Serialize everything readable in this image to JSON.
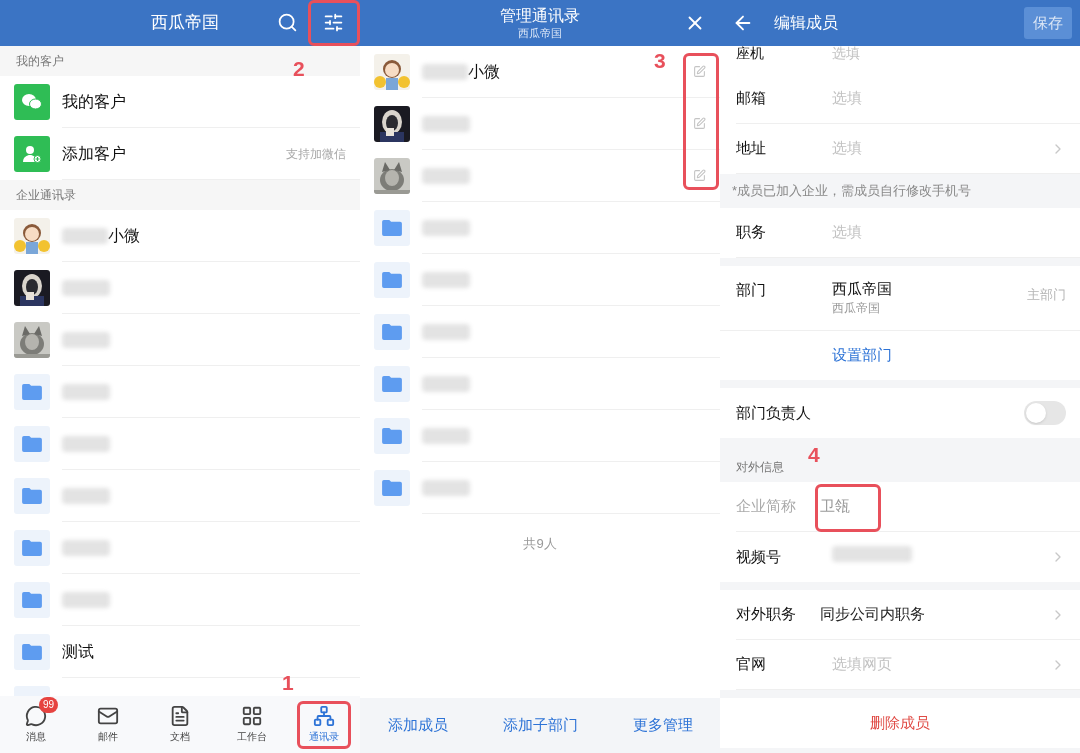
{
  "contacts_screen": {
    "title": "西瓜帝国",
    "sections": [
      {
        "header": "我的客户",
        "items": [
          {
            "kind": "wechat",
            "name": "我的客户",
            "blurred": false
          },
          {
            "kind": "add",
            "name": "添加客户",
            "note": "支持加微信",
            "blurred": false
          }
        ]
      },
      {
        "header": "企业通讯录",
        "items": [
          {
            "kind": "member",
            "blurred": true,
            "name": "小微"
          },
          {
            "kind": "member",
            "blurred": true
          },
          {
            "kind": "member",
            "blurred": true
          },
          {
            "kind": "folder",
            "blurred": true
          },
          {
            "kind": "folder",
            "blurred": true
          },
          {
            "kind": "folder",
            "blurred": true
          },
          {
            "kind": "folder",
            "blurred": true
          },
          {
            "kind": "folder",
            "blurred": true
          },
          {
            "kind": "folder",
            "name": "测试",
            "blurred": false
          },
          {
            "kind": "folder",
            "blurred": false
          }
        ]
      }
    ],
    "tabs": [
      {
        "label": "消息",
        "badge": "99",
        "selected": false
      },
      {
        "label": "邮件",
        "selected": false
      },
      {
        "label": "文档",
        "selected": false
      },
      {
        "label": "工作台",
        "selected": false
      },
      {
        "label": "通讯录",
        "selected": true
      }
    ]
  },
  "manage_screen": {
    "title": "管理通讯录",
    "subtitle": "西瓜帝国",
    "items": [
      {
        "kind": "member",
        "blurred": true,
        "name": "小微"
      },
      {
        "kind": "member",
        "blurred": true
      },
      {
        "kind": "member",
        "blurred": true
      },
      {
        "kind": "folder",
        "blurred": true
      },
      {
        "kind": "folder",
        "blurred": true
      },
      {
        "kind": "folder",
        "blurred": true
      },
      {
        "kind": "folder",
        "blurred": true
      },
      {
        "kind": "folder",
        "blurred": true
      },
      {
        "kind": "folder",
        "blurred": true
      }
    ],
    "count": "共9人",
    "actions": [
      "添加成员",
      "添加子部门",
      "更多管理"
    ]
  },
  "edit_screen": {
    "title": "编辑成员",
    "save": "保存",
    "rows": [
      {
        "kind": "cut",
        "label": "座机",
        "placeholder": "选填"
      },
      {
        "kind": "field",
        "label": "邮箱",
        "placeholder": "选填",
        "chevron": false
      },
      {
        "kind": "field",
        "label": "地址",
        "placeholder": "选填",
        "chevron": true
      },
      {
        "kind": "note",
        "text": "*成员已加入企业，需成员自行修改手机号"
      },
      {
        "kind": "field",
        "label": "职务",
        "placeholder": "选填",
        "chevron": false
      },
      {
        "kind": "gap"
      },
      {
        "kind": "department",
        "label": "部门",
        "value": "西瓜帝国",
        "sub": "西瓜帝国",
        "tag": "主部门"
      },
      {
        "kind": "link",
        "text": "设置部门"
      },
      {
        "kind": "gap"
      },
      {
        "kind": "toggle",
        "label": "部门负责人",
        "on": false
      },
      {
        "kind": "section",
        "text": "对外信息"
      },
      {
        "kind": "value",
        "label": "企业简称",
        "value": "卫瓴",
        "disabled": true,
        "chevron": false
      },
      {
        "kind": "blurred",
        "label": "视频号",
        "chevron": true
      },
      {
        "kind": "gap"
      },
      {
        "kind": "value",
        "label": "对外职务",
        "value": "同步公司内职务",
        "disabled": false,
        "chevron": true
      },
      {
        "kind": "field",
        "label": "官网",
        "placeholder": "选填网页",
        "chevron": true
      },
      {
        "kind": "gap"
      },
      {
        "kind": "delete",
        "text": "删除成员"
      }
    ]
  },
  "annotations": [
    {
      "label": "1"
    },
    {
      "label": "2"
    },
    {
      "label": "3"
    },
    {
      "label": "4"
    }
  ]
}
